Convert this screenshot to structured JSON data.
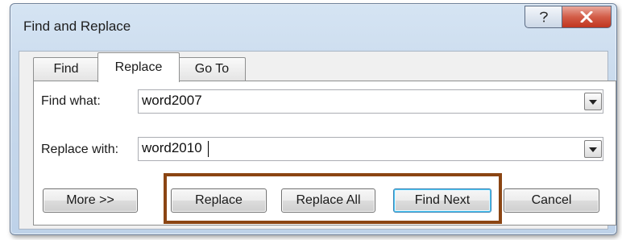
{
  "window": {
    "title": "Find and Replace",
    "help_icon": "question-mark-icon",
    "close_icon": "close-x-icon"
  },
  "tabs": [
    {
      "label": "Find",
      "active": false
    },
    {
      "label": "Replace",
      "active": true
    },
    {
      "label": "Go To",
      "active": false
    }
  ],
  "find": {
    "label": "Find what:",
    "value": "word2007"
  },
  "replace": {
    "label": "Replace with:",
    "value": "word2010"
  },
  "buttons": {
    "more": "More >>",
    "replace": "Replace",
    "replace_all": "Replace All",
    "find_next": "Find Next",
    "cancel": "Cancel"
  },
  "colors": {
    "highlight_box": "#8b4513",
    "title_bar": "#c8d9ec",
    "close_button": "#c0351f"
  }
}
